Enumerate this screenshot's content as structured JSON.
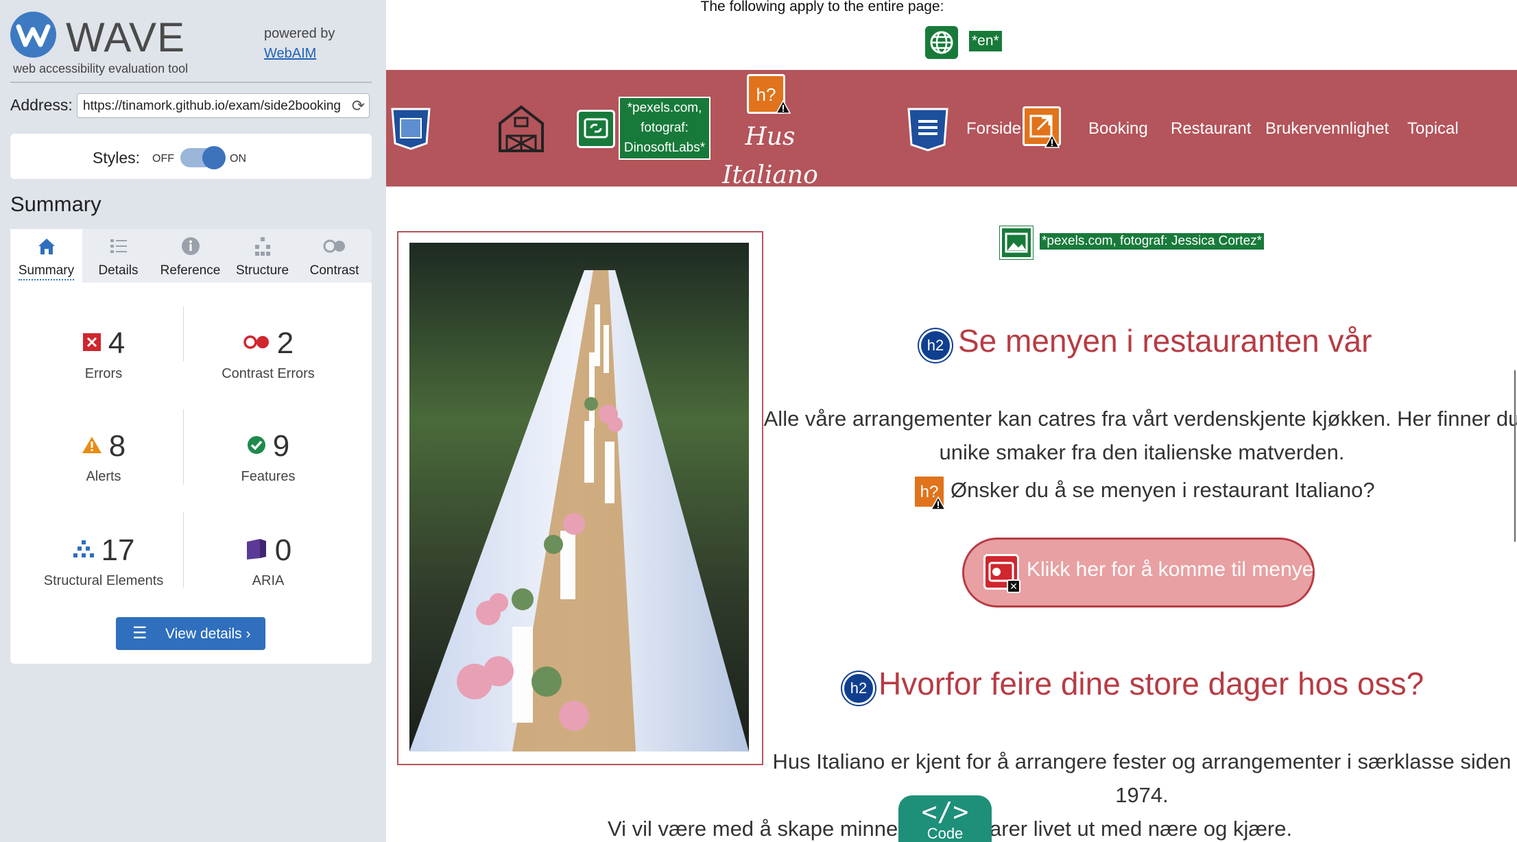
{
  "wave": {
    "logo_text": "WAVE",
    "subtitle": "web accessibility evaluation tool",
    "powered_by": "powered by",
    "webaim_link": "WebAIM",
    "address_label": "Address:",
    "address_value": "https://tinamork.github.io/exam/side2booking",
    "styles_label": "Styles:",
    "styles_off": "OFF",
    "styles_on": "ON",
    "summary_heading": "Summary",
    "tabs": [
      {
        "label": "Summary",
        "icon": "home-icon"
      },
      {
        "label": "Details",
        "icon": "list-icon"
      },
      {
        "label": "Reference",
        "icon": "info-icon"
      },
      {
        "label": "Structure",
        "icon": "structure-icon"
      },
      {
        "label": "Contrast",
        "icon": "contrast-icon"
      }
    ],
    "stats": {
      "errors": {
        "count": "4",
        "label": "Errors"
      },
      "contrast": {
        "count": "2",
        "label": "Contrast Errors"
      },
      "alerts": {
        "count": "8",
        "label": "Alerts"
      },
      "features": {
        "count": "9",
        "label": "Features"
      },
      "structural": {
        "count": "17",
        "label": "Structural Elements"
      },
      "aria": {
        "count": "0",
        "label": "ARIA"
      }
    },
    "view_details": "View details ›",
    "colors": {
      "accent": "#2f6fbd",
      "error": "#d0262e",
      "alert": "#e88c12",
      "feature": "#1f8a4c",
      "aria": "#5b3a97"
    }
  },
  "site": {
    "page_note": "The following apply to the entire page:",
    "lang_tag": "*en*",
    "logo_alt_tag": "*pexels.com, fotograf: DinosoftLabs*",
    "h_alert_tag": "h?",
    "brand_line1": "Hus",
    "brand_line2": "Italiano",
    "nav": [
      "Forside",
      "Booking",
      "Restaurant",
      "Brukervennlighet",
      "Topical"
    ],
    "photo_caption": "*pexels.com, fotograf: Jessica Cortez*",
    "h2_badge": "h2",
    "heading1": "Se menyen i restauranten vår",
    "para1_line1": "Alle våre arrangementer kan catres fra vårt verdenskjente kjøkken. Her finner du",
    "para1_line2": "unike smaker fra den italienske matverden.",
    "question": "Ønsker du å se menyen i restaurant Italiano?",
    "cta_label": "Klikk her for å komme til menyen",
    "heading2": "Hvorfor feire dine store dager hos oss?",
    "para2_line1": "Hus Italiano er kjent for å arrangere fester og arrangementer i særklasse siden",
    "para2_line2": "1974.",
    "para3_left": "Vi vil være med å skape minne",
    "para3_right": "arer livet ut med nære og kjære.",
    "code_label": "Code",
    "code_icon": "</>",
    "colors": {
      "header": "#b4545b",
      "heading": "#b73c44",
      "badge_green": "#187a3a",
      "h2_badge": "#103f8f"
    }
  }
}
